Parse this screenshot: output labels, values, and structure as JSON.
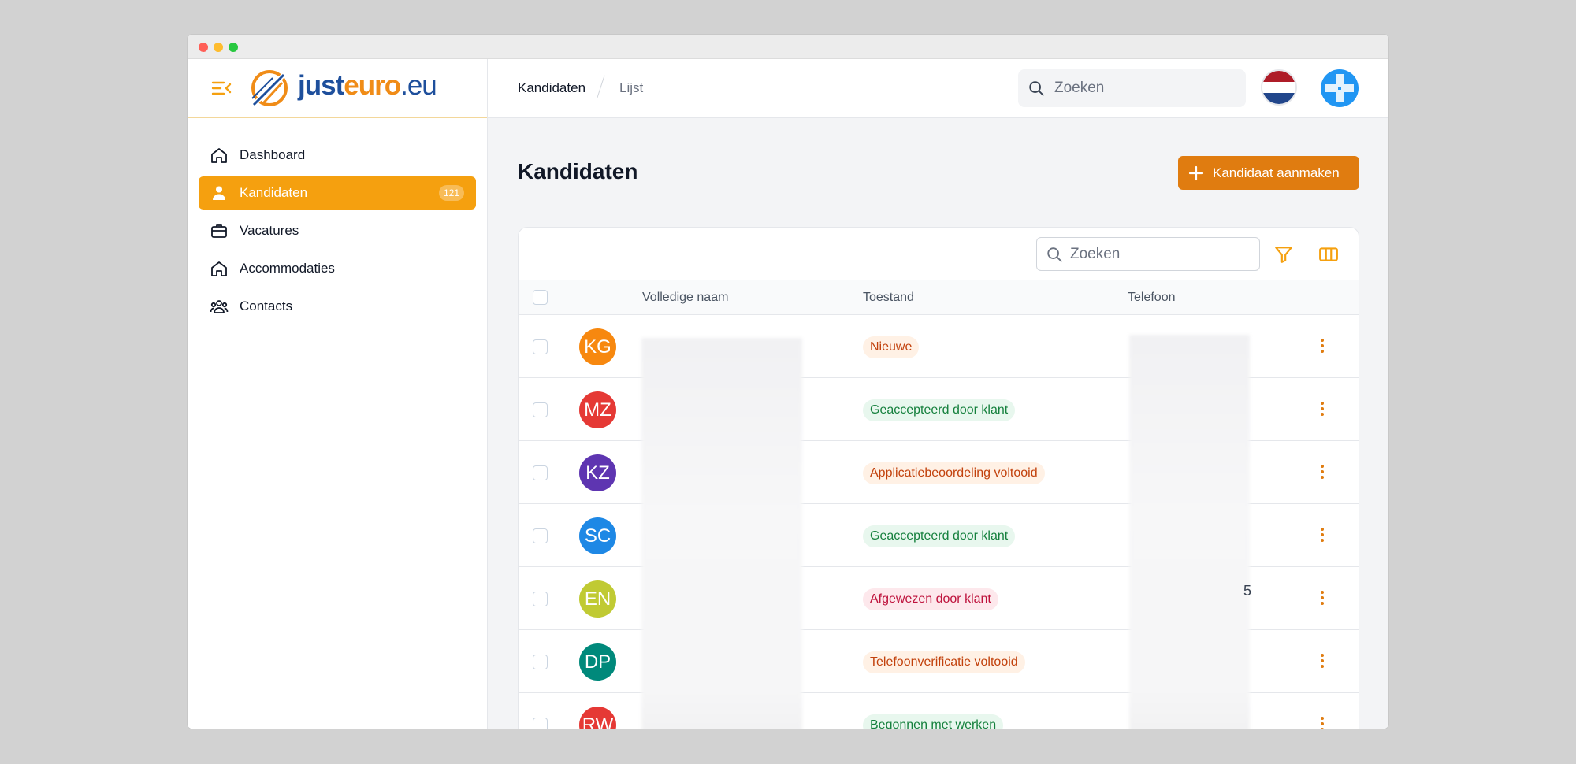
{
  "brand": {
    "just": "just",
    "euro": "euro",
    "tld": ".eu"
  },
  "sidebar": {
    "items": [
      {
        "label": "Dashboard",
        "icon": "home-icon"
      },
      {
        "label": "Kandidaten",
        "icon": "user-icon",
        "badge": "121",
        "active": true
      },
      {
        "label": "Vacatures",
        "icon": "briefcase-icon"
      },
      {
        "label": "Accommodaties",
        "icon": "home-icon"
      },
      {
        "label": "Contacts",
        "icon": "users-icon"
      }
    ]
  },
  "header": {
    "breadcrumb": [
      "Kandidaten",
      "Lijst"
    ],
    "search_placeholder": "Zoeken"
  },
  "page": {
    "title": "Kandidaten",
    "create_button": "Kandidaat aanmaken"
  },
  "table": {
    "search_placeholder": "Zoeken",
    "columns": [
      "Volledige naam",
      "Toestand",
      "Telefoon"
    ],
    "rows": [
      {
        "initials": "KG",
        "color": "#f7880f",
        "status": "Nieuwe",
        "status_kind": "orange",
        "phone_fragment": ""
      },
      {
        "initials": "MZ",
        "color": "#e53935",
        "status": "Geaccepteerd door klant",
        "status_kind": "green",
        "phone_fragment": ""
      },
      {
        "initials": "KZ",
        "color": "#5e35b1",
        "status": "Applicatiebeoordeling voltooid",
        "status_kind": "orange",
        "phone_fragment": ""
      },
      {
        "initials": "SC",
        "color": "#1e88e5",
        "status": "Geaccepteerd door klant",
        "status_kind": "green",
        "phone_fragment": ""
      },
      {
        "initials": "EN",
        "color": "#c0ca33",
        "status": "Afgewezen door klant",
        "status_kind": "red",
        "phone_fragment": "5"
      },
      {
        "initials": "DP",
        "color": "#00897b",
        "status": "Telefoonverificatie voltooid",
        "status_kind": "orange",
        "phone_fragment": "\t"
      },
      {
        "initials": "RW",
        "color": "#e53935",
        "status": "Begonnen met werken",
        "status_kind": "green",
        "phone_fragment": ""
      }
    ]
  },
  "colors": {
    "accent": "#f5a00f",
    "button": "#e07c10",
    "brand_blue": "#1e4f9c"
  }
}
